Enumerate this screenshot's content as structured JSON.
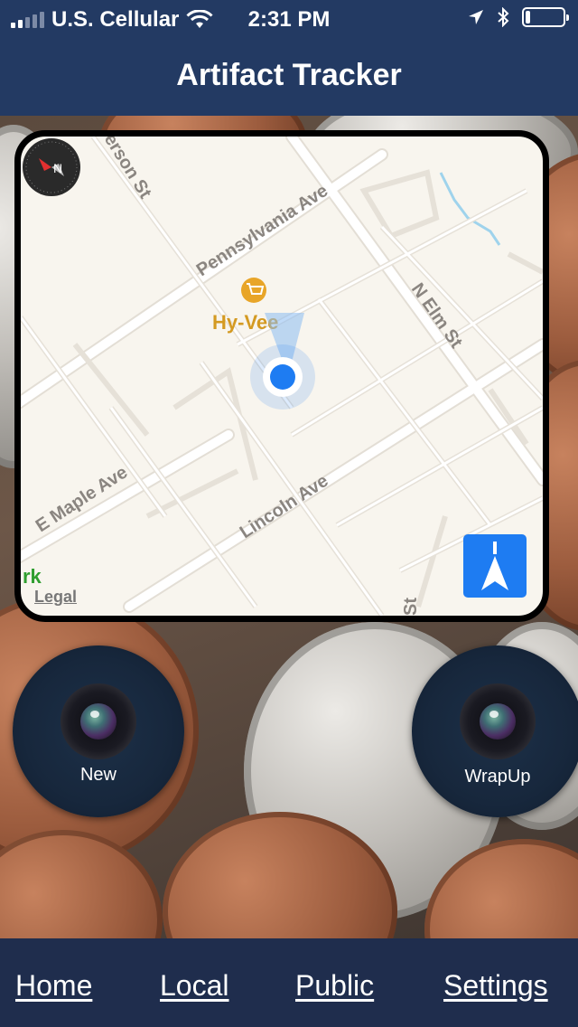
{
  "status_bar": {
    "carrier": "U.S. Cellular",
    "time": "2:31 PM",
    "icons": [
      "signal-icon",
      "wifi-icon",
      "location-arrow-icon",
      "bluetooth-icon",
      "battery-icon"
    ],
    "battery_level": 0.12
  },
  "header": {
    "title": "Artifact Tracker"
  },
  "map": {
    "streets": [
      "Pennsylvania Ave",
      "N Elm St",
      "E Maple Ave",
      "Lincoln Ave",
      "erson St",
      "St"
    ],
    "poi": {
      "name": "Hy-Vee",
      "icon": "shopping-cart-icon"
    },
    "partial_label": "rk",
    "legal_label": "Legal",
    "compass_label": "N",
    "colors": {
      "land": "#f8f5ee",
      "road": "#ffffff",
      "poi": "#e0a020",
      "user_dot": "#1e7cf2",
      "water": "#9fd3ec"
    }
  },
  "camera_buttons": {
    "new_label": "New",
    "wrapup_label": "WrapUp"
  },
  "nav": {
    "home": "Home",
    "local": "Local",
    "public": "Public",
    "settings": "Settings"
  }
}
